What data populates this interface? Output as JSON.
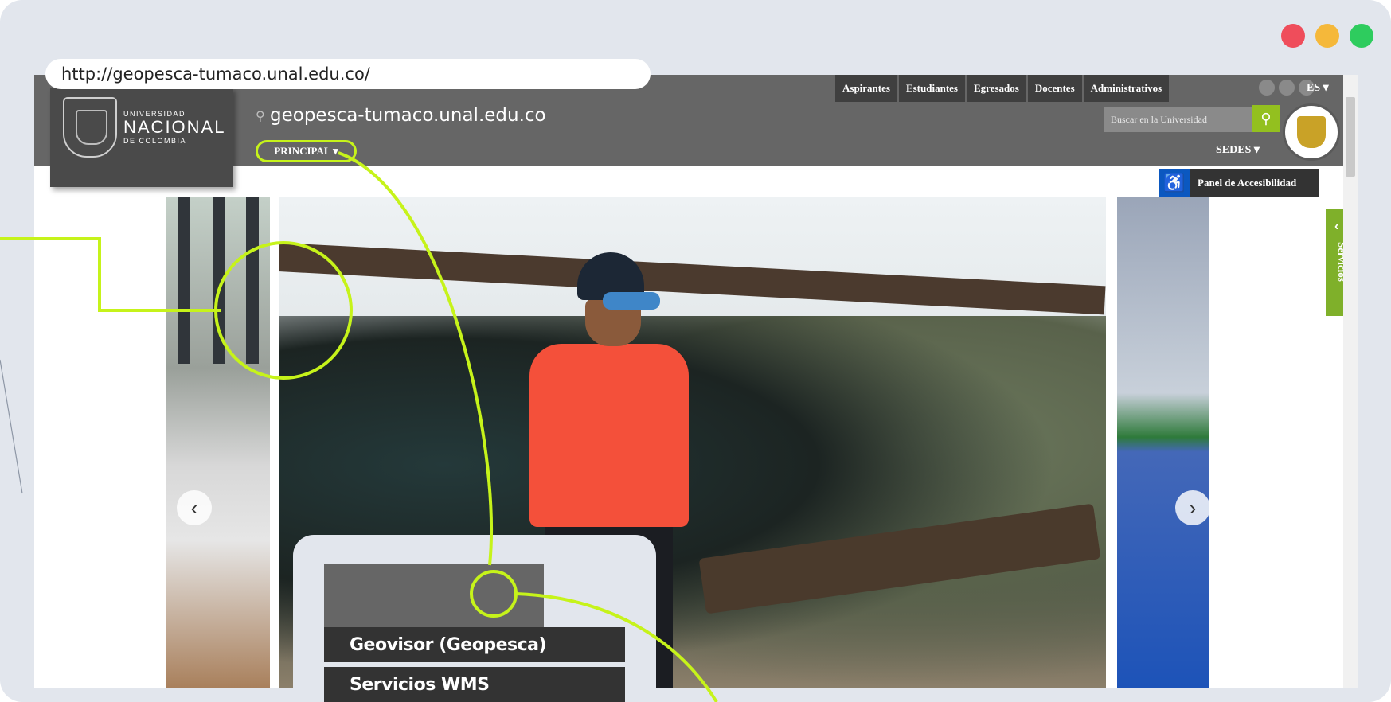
{
  "colors": {
    "frame_bg": "#e2e6ed",
    "header_bg": "#666666",
    "highlight": "#c6f31a",
    "accent_green": "#7fb02a",
    "access_blue": "#0b58c0",
    "menu_bg": "#333333"
  },
  "window_controls": [
    {
      "name": "close",
      "color": "#ef4d5b"
    },
    {
      "name": "minimize",
      "color": "#f5b83a"
    },
    {
      "name": "maximize",
      "color": "#2ecc5e"
    }
  ],
  "address_bar": {
    "url": "http://geopesca-tumaco.unal.edu.co/"
  },
  "header": {
    "top_nav": [
      "Aspirantes",
      "Estudiantes",
      "Egresados",
      "Docentes",
      "Administrativos"
    ],
    "social_icons": [
      "facebook-icon",
      "twitter-icon",
      "youtube-icon"
    ],
    "language": "ES ▾",
    "logo": {
      "line1": "UNIVERSIDAD",
      "line2": "NACIONAL",
      "line3": "DE COLOMBIA"
    },
    "site_title": "geopesca-tumaco.unal.edu.co",
    "principal_menu": "PRINCIPAL ▾",
    "search_placeholder": "Buscar en la Universidad",
    "sedes": "SEDES ▾"
  },
  "accessibility": {
    "label": "Panel de Accesibilidad"
  },
  "side_tab": {
    "label": "Servicios"
  },
  "carousel": {
    "prev": "‹",
    "next": "›"
  },
  "dropdown_menu": {
    "items": [
      "Geovisor (Geopesca)",
      "Servicios WMS"
    ]
  }
}
